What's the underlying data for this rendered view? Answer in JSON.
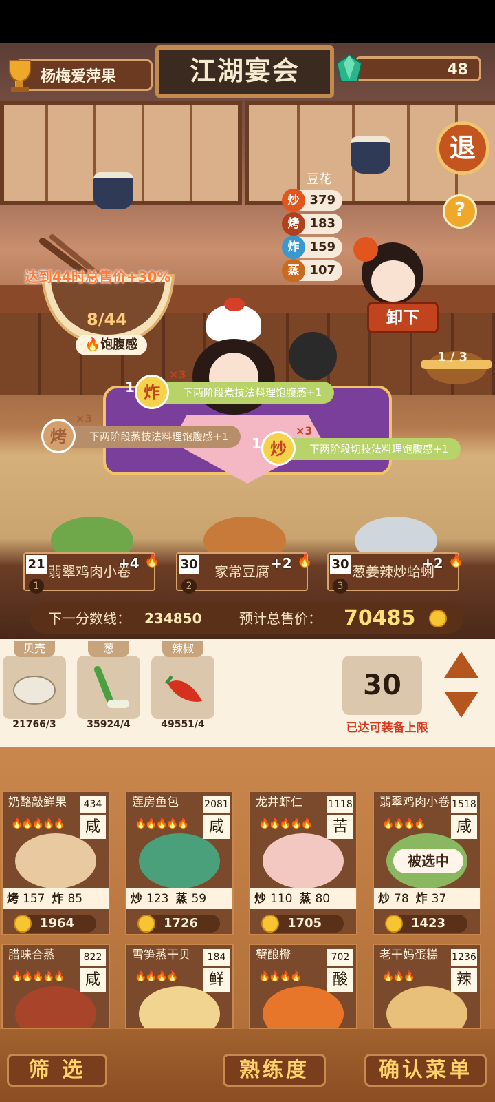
{
  "header": {
    "player_name": "杨梅爱萍果",
    "title": "江湖宴会",
    "gems": "48",
    "exit_label": "退",
    "help_label": "?"
  },
  "chef": {
    "name": "豆花",
    "skills": [
      {
        "label": "炒",
        "value": "379",
        "color": "#e0561e"
      },
      {
        "label": "烤",
        "value": "183",
        "color": "#b0401e"
      },
      {
        "label": "炸",
        "value": "159",
        "color": "#3a98d0"
      },
      {
        "label": "蒸",
        "value": "107",
        "color": "#c96a1e"
      }
    ],
    "unload_label": "卸下",
    "page": "1 / 3"
  },
  "satiety": {
    "bonus_text": "达到44时总售价+30%",
    "fill": "8/44",
    "label": "饱腹感"
  },
  "buffs": [
    {
      "level": "1",
      "skill": "炸",
      "mult": "×3",
      "text": "下两阶段煮技法料理饱腹感+1",
      "dim": false
    },
    {
      "level": "",
      "skill": "烤",
      "mult": "×3",
      "text": "下两阶段蒸技法料理饱腹感+1",
      "dim": true
    },
    {
      "level": "1",
      "skill": "炒",
      "mult": "×3",
      "text": "下两阶段切技法料理饱腹感+1",
      "dim": false
    }
  ],
  "dishes": [
    {
      "count": "21",
      "slot": "1",
      "name": "翡翠鸡肉小卷",
      "bonus": "+4"
    },
    {
      "count": "30",
      "slot": "2",
      "name": "家常豆腐",
      "bonus": "+2"
    },
    {
      "count": "30",
      "slot": "3",
      "name": "葱姜辣炒蛤蜊",
      "bonus": "+2"
    }
  ],
  "score": {
    "next_label": "下一分数线：",
    "next_value": "234850",
    "total_label": "预计总售价：",
    "total_value": "70485"
  },
  "ingredients": [
    {
      "tag": "贝壳",
      "count": "21766/3",
      "icon": "shell-icon"
    },
    {
      "tag": "葱",
      "count": "35924/4",
      "icon": "scallion-icon"
    },
    {
      "tag": "辣椒",
      "count": "49551/4",
      "icon": "chili-icon"
    }
  ],
  "quantity": {
    "value": "30",
    "note": "已达可装备上限"
  },
  "menu": [
    {
      "name": "奶酪敲鲜果",
      "badge": "434",
      "taste": "咸",
      "fires": "🔥🔥🔥🔥🔥",
      "skills": [
        [
          "烤",
          "157"
        ],
        [
          "炸",
          "85"
        ]
      ],
      "price": "1964",
      "selected": false,
      "up": false,
      "plate": "#e8c9a0"
    },
    {
      "name": "莲房鱼包",
      "badge": "2081",
      "taste": "咸",
      "fires": "🔥🔥🔥🔥🔥",
      "skills": [
        [
          "炒",
          "123"
        ],
        [
          "蒸",
          "59"
        ]
      ],
      "price": "1726",
      "selected": false,
      "up": false,
      "plate": "#4aa07a"
    },
    {
      "name": "龙井虾仁",
      "badge": "1118",
      "taste": "苦",
      "fires": "🔥🔥🔥🔥🔥",
      "skills": [
        [
          "炒",
          "110"
        ],
        [
          "蒸",
          "80"
        ]
      ],
      "price": "1705",
      "selected": false,
      "up": false,
      "plate": "#f2c8c0"
    },
    {
      "name": "翡翠鸡肉小卷",
      "badge": "1518",
      "taste": "咸",
      "fires": "🔥🔥🔥🔥",
      "skills": [
        [
          "炒",
          "78"
        ],
        [
          "炸",
          "37"
        ]
      ],
      "price": "1423",
      "selected": true,
      "up": true,
      "plate": "#8ab860"
    },
    {
      "name": "腊味合蒸",
      "badge": "822",
      "taste": "咸",
      "fires": "🔥🔥🔥🔥🔥",
      "skills": [],
      "price": "",
      "selected": false,
      "up": false,
      "plate": "#a8442a"
    },
    {
      "name": "雪笋蒸干贝",
      "badge": "184",
      "taste": "鲜",
      "fires": "🔥🔥🔥🔥",
      "skills": [],
      "price": "",
      "selected": false,
      "up": false,
      "plate": "#f0d490"
    },
    {
      "name": "蟹酿橙",
      "badge": "702",
      "taste": "酸",
      "fires": "🔥🔥🔥🔥",
      "skills": [],
      "price": "",
      "selected": false,
      "up": false,
      "plate": "#e8762a"
    },
    {
      "name": "老干妈蛋糕",
      "badge": "1236",
      "taste": "辣",
      "fires": "🔥🔥🔥",
      "skills": [],
      "price": "",
      "selected": false,
      "up": false,
      "plate": "#e8c07a"
    }
  ],
  "selected_label": "被选中",
  "bottom": {
    "filter": "筛 选",
    "proficiency": "熟练度",
    "confirm": "确认菜单"
  }
}
